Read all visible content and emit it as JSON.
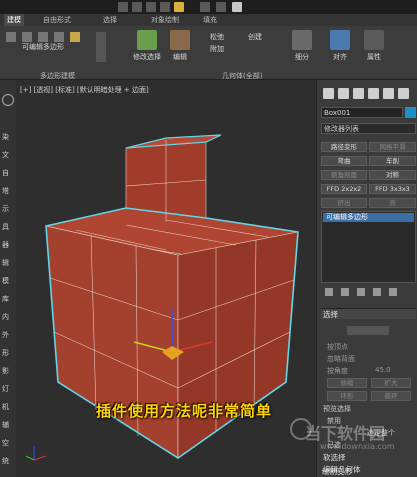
{
  "ribbon": {
    "tabs": [
      "建模",
      "自由形式",
      "选择",
      "对象绘制",
      "填充"
    ],
    "active_tab": "建模",
    "poly_label": "可编辑多边形",
    "group_poly": "多边形建模",
    "modify_select": "修改选择",
    "edit": "编辑",
    "geometry_group": "几何体(全部)",
    "fold": "松弛",
    "attach": "附加",
    "bevel": "创建",
    "subdivide": "细分",
    "align": "对齐",
    "properties": "属性"
  },
  "left_toolbar": {
    "chars": [
      "染",
      "文",
      "自",
      "塔",
      "示",
      "具",
      "器",
      "辑",
      "模",
      "库",
      "内",
      "外",
      "形",
      "影",
      "灯",
      "机",
      "辅",
      "空",
      "统"
    ]
  },
  "viewport": {
    "label": "[+] [透视] [标准] [默认明暗处理 + 边面]"
  },
  "subtitle": "插件使用方法呢非常简单",
  "panel": {
    "object_name": "Box001",
    "modifier_list": "修改器列表",
    "buttons": [
      "路径变形",
      "网格平滑",
      "弯曲",
      "车削",
      "倒角剖面",
      "对称",
      "FFD 2x2x2",
      "FFD 3x3x3",
      "挤出",
      "壳"
    ],
    "stack_item": "可编辑多边形",
    "rollout_select": "选择",
    "opt_vertex": "按顶点",
    "opt_ignore": "忽略背面",
    "opt_angle": "按角度",
    "angle_val": "45.0",
    "shrink": "收缩",
    "grow": "扩大",
    "ring": "环形",
    "loop": "循环",
    "preview": "预览选择",
    "off": "禁用",
    "rollout_soft": "软选择",
    "rollout_edit": "编辑几何体",
    "rollout_paint": "绘制变形",
    "extra1": "选定整个",
    "extra2": "已选"
  },
  "watermark": {
    "main": "当下软件园",
    "url": "www.downxia.com"
  },
  "colors": {
    "box_fill": "#a8412f",
    "box_edge": "#63d6e6",
    "accent": "#1e90c8",
    "subtitle": "#ffd400"
  }
}
